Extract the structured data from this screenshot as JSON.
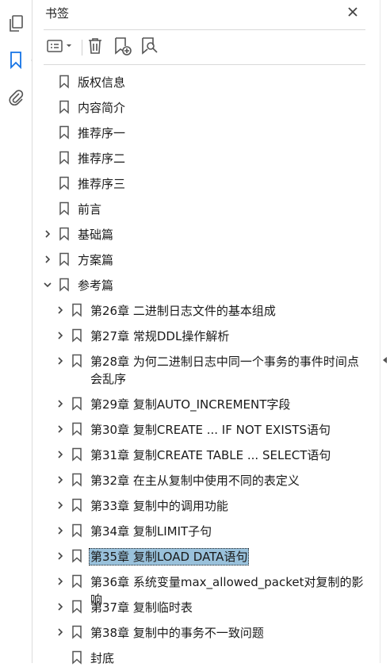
{
  "panel": {
    "title": "书签"
  },
  "rail": {
    "items": [
      {
        "icon": "pages-icon"
      },
      {
        "icon": "bookmark-icon",
        "active": true
      },
      {
        "icon": "paperclip-icon"
      }
    ]
  },
  "toolbar": {
    "items": [
      {
        "icon": "options-menu-icon"
      },
      {
        "icon": "trash-icon"
      },
      {
        "icon": "add-bookmark-icon"
      },
      {
        "icon": "bookmark-search-icon"
      }
    ]
  },
  "colors": {
    "selection": "#99c1db",
    "icon": "#555555"
  },
  "bookmarks": [
    {
      "label": "版权信息",
      "level": 0,
      "expander": "none"
    },
    {
      "label": "内容简介",
      "level": 0,
      "expander": "none"
    },
    {
      "label": "推荐序一",
      "level": 0,
      "expander": "none"
    },
    {
      "label": "推荐序二",
      "level": 0,
      "expander": "none"
    },
    {
      "label": "推荐序三",
      "level": 0,
      "expander": "none"
    },
    {
      "label": "前言",
      "level": 0,
      "expander": "none"
    },
    {
      "label": "基础篇",
      "level": 0,
      "expander": "collapsed"
    },
    {
      "label": "方案篇",
      "level": 0,
      "expander": "collapsed"
    },
    {
      "label": "参考篇",
      "level": 0,
      "expander": "expanded"
    },
    {
      "label": "第26章 二进制日志文件的基本组成",
      "level": 1,
      "expander": "collapsed"
    },
    {
      "label": "第27章 常规DDL操作解析",
      "level": 1,
      "expander": "collapsed"
    },
    {
      "label": "第28章 为何二进制日志中同一个事务的事件时间点会乱序",
      "level": 1,
      "expander": "collapsed",
      "lines": 2
    },
    {
      "label": "第29章 复制AUTO_INCREMENT字段",
      "level": 1,
      "expander": "collapsed"
    },
    {
      "label": "第30章 复制CREATE ... IF NOT EXISTS语句",
      "level": 1,
      "expander": "collapsed"
    },
    {
      "label": "第31章 复制CREATE TABLE ... SELECT语句",
      "level": 1,
      "expander": "collapsed"
    },
    {
      "label": "第32章 在主从复制中使用不同的表定义",
      "level": 1,
      "expander": "collapsed"
    },
    {
      "label": "第33章 复制中的调用功能",
      "level": 1,
      "expander": "collapsed"
    },
    {
      "label": "第34章 复制LIMIT子句",
      "level": 1,
      "expander": "collapsed"
    },
    {
      "label": "第35章 复制LOAD DATA语句",
      "level": 1,
      "expander": "collapsed",
      "selected": true
    },
    {
      "label": "第36章 系统变量max_allowed_packet对复制的影响",
      "level": 1,
      "expander": "collapsed"
    },
    {
      "label": "第37章 复制临时表",
      "level": 1,
      "expander": "collapsed"
    },
    {
      "label": "第38章 复制中的事务不一致问题",
      "level": 1,
      "expander": "collapsed"
    },
    {
      "label": "封底",
      "level": 1,
      "expander": "none"
    }
  ]
}
